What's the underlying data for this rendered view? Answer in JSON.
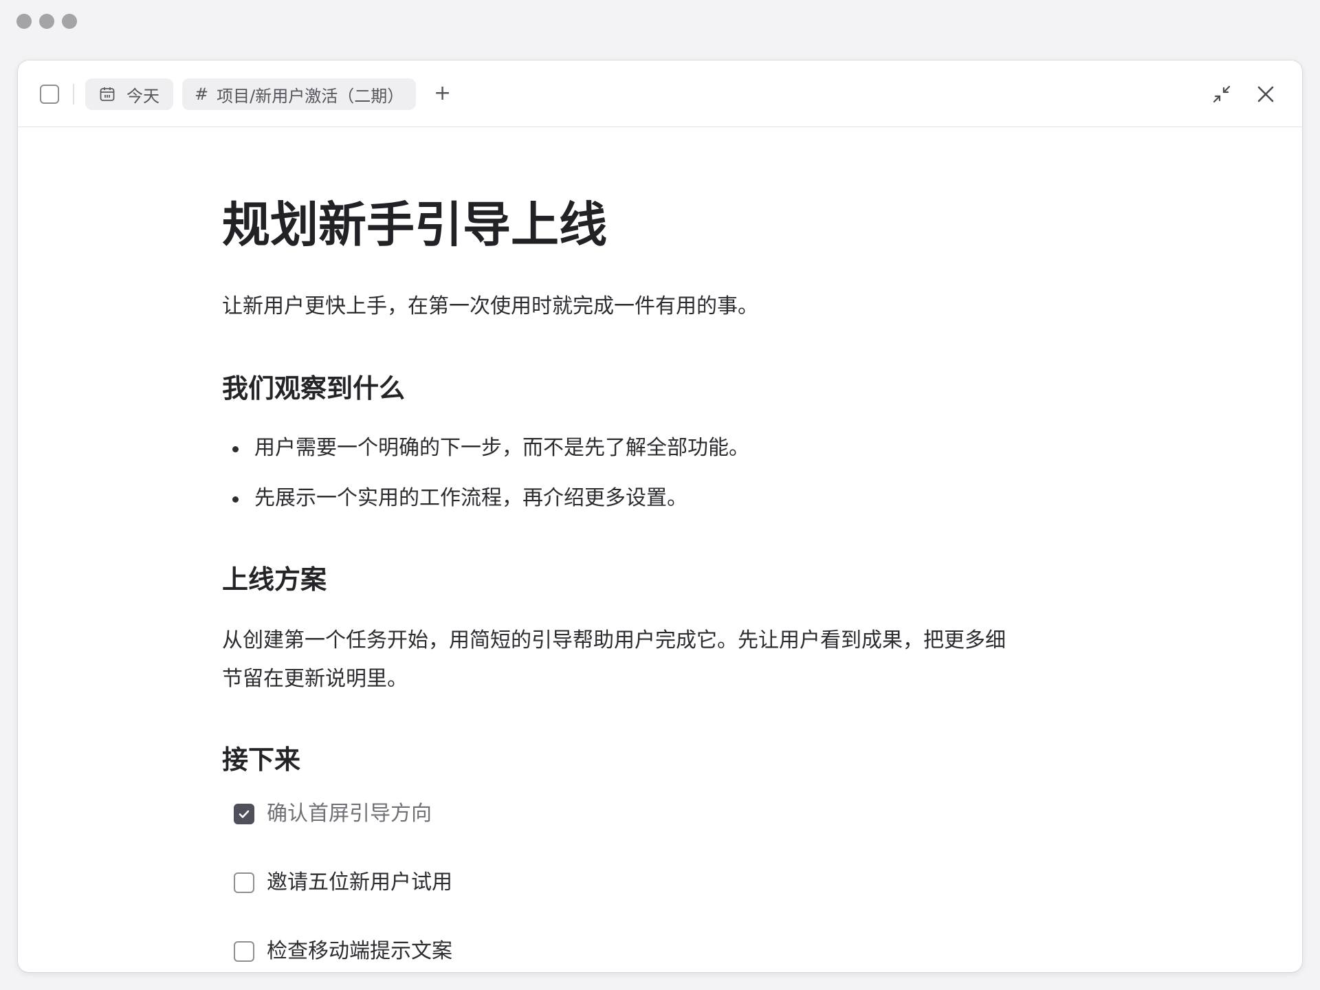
{
  "toolbar": {
    "date_chip": "今天",
    "tag_chip": "项目/新用户激活（二期）",
    "add_label": "+"
  },
  "doc": {
    "title": "规划新手引导上线",
    "intro": "让新用户更快上手，在第一次使用时就完成一件有用的事。",
    "section1": {
      "heading": "我们观察到什么",
      "bullets": [
        "用户需要一个明确的下一步，而不是先了解全部功能。",
        "先展示一个实用的工作流程，再介绍更多设置。"
      ]
    },
    "section2": {
      "heading": "上线方案",
      "line1": "从创建第一个任务开始，用简短的引导帮助用户完成它。先让用户看到成果，把更多细",
      "line2": "节留在更新说明里。"
    },
    "section3": {
      "heading": "接下来",
      "tasks": [
        {
          "label": "确认首屏引导方向",
          "checked": true
        },
        {
          "label": "邀请五位新用户试用",
          "checked": false
        },
        {
          "label": "检查移动端提示文案",
          "checked": false
        }
      ]
    }
  },
  "icons": {
    "date": "calendar-icon",
    "collapse": "collapse-icon",
    "close": "close-icon",
    "check": "checkmark-icon"
  },
  "colors": {
    "checked_box": "#50505a",
    "chip_bg": "#efeff1"
  }
}
